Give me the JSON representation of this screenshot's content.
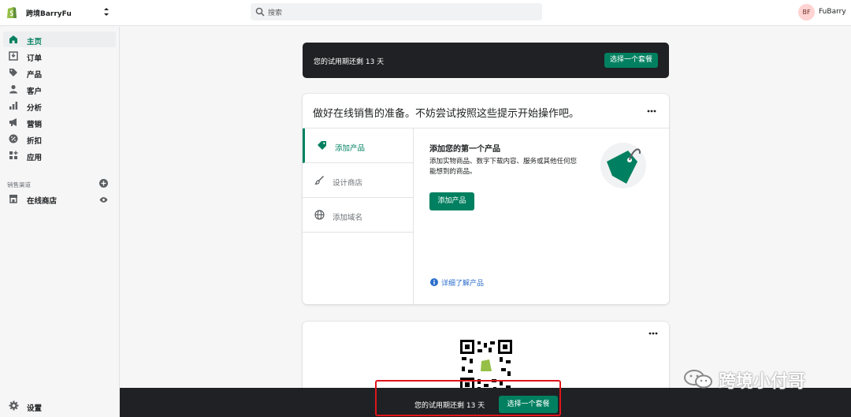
{
  "topbar": {
    "store_name": "跨境BarryFu",
    "search_placeholder": "搜索",
    "avatar_initials": "BF",
    "user_name": "FuBarry"
  },
  "sidebar": {
    "items": [
      {
        "label": "主页",
        "icon": "home-icon"
      },
      {
        "label": "订单",
        "icon": "orders-icon"
      },
      {
        "label": "产品",
        "icon": "tag-icon"
      },
      {
        "label": "客户",
        "icon": "person-icon"
      },
      {
        "label": "分析",
        "icon": "bar-chart-icon"
      },
      {
        "label": "营销",
        "icon": "megaphone-icon"
      },
      {
        "label": "折扣",
        "icon": "discount-icon"
      },
      {
        "label": "应用",
        "icon": "apps-icon"
      }
    ],
    "channels_title": "销售渠道",
    "online_store": "在线商店",
    "settings": "设置"
  },
  "trial_banner": {
    "text": "您的试用期还剩 13 天",
    "button": "选择一个套餐"
  },
  "setup_card": {
    "heading": "做好在线销售的准备。不妨尝试按照这些提示开始操作吧。",
    "tabs": [
      {
        "label": "添加产品",
        "icon": "tag-icon"
      },
      {
        "label": "设计商店",
        "icon": "brush-icon"
      },
      {
        "label": "添加域名",
        "icon": "globe-icon"
      }
    ],
    "panel_title": "添加您的第一个产品",
    "panel_desc": "添加实物商品、数字下载内容、服务或其他任何您能想到的商品。",
    "panel_button": "添加产品",
    "learn_more": "详细了解产品"
  },
  "footer_bar": {
    "text": "您的试用期还剩 13 天",
    "button": "选择一个套餐"
  },
  "watermark": "跨境小付哥",
  "colors": {
    "accent": "#008060",
    "dark": "#1f2124",
    "highlight": "#e0151b",
    "link": "#2c6ecb"
  }
}
